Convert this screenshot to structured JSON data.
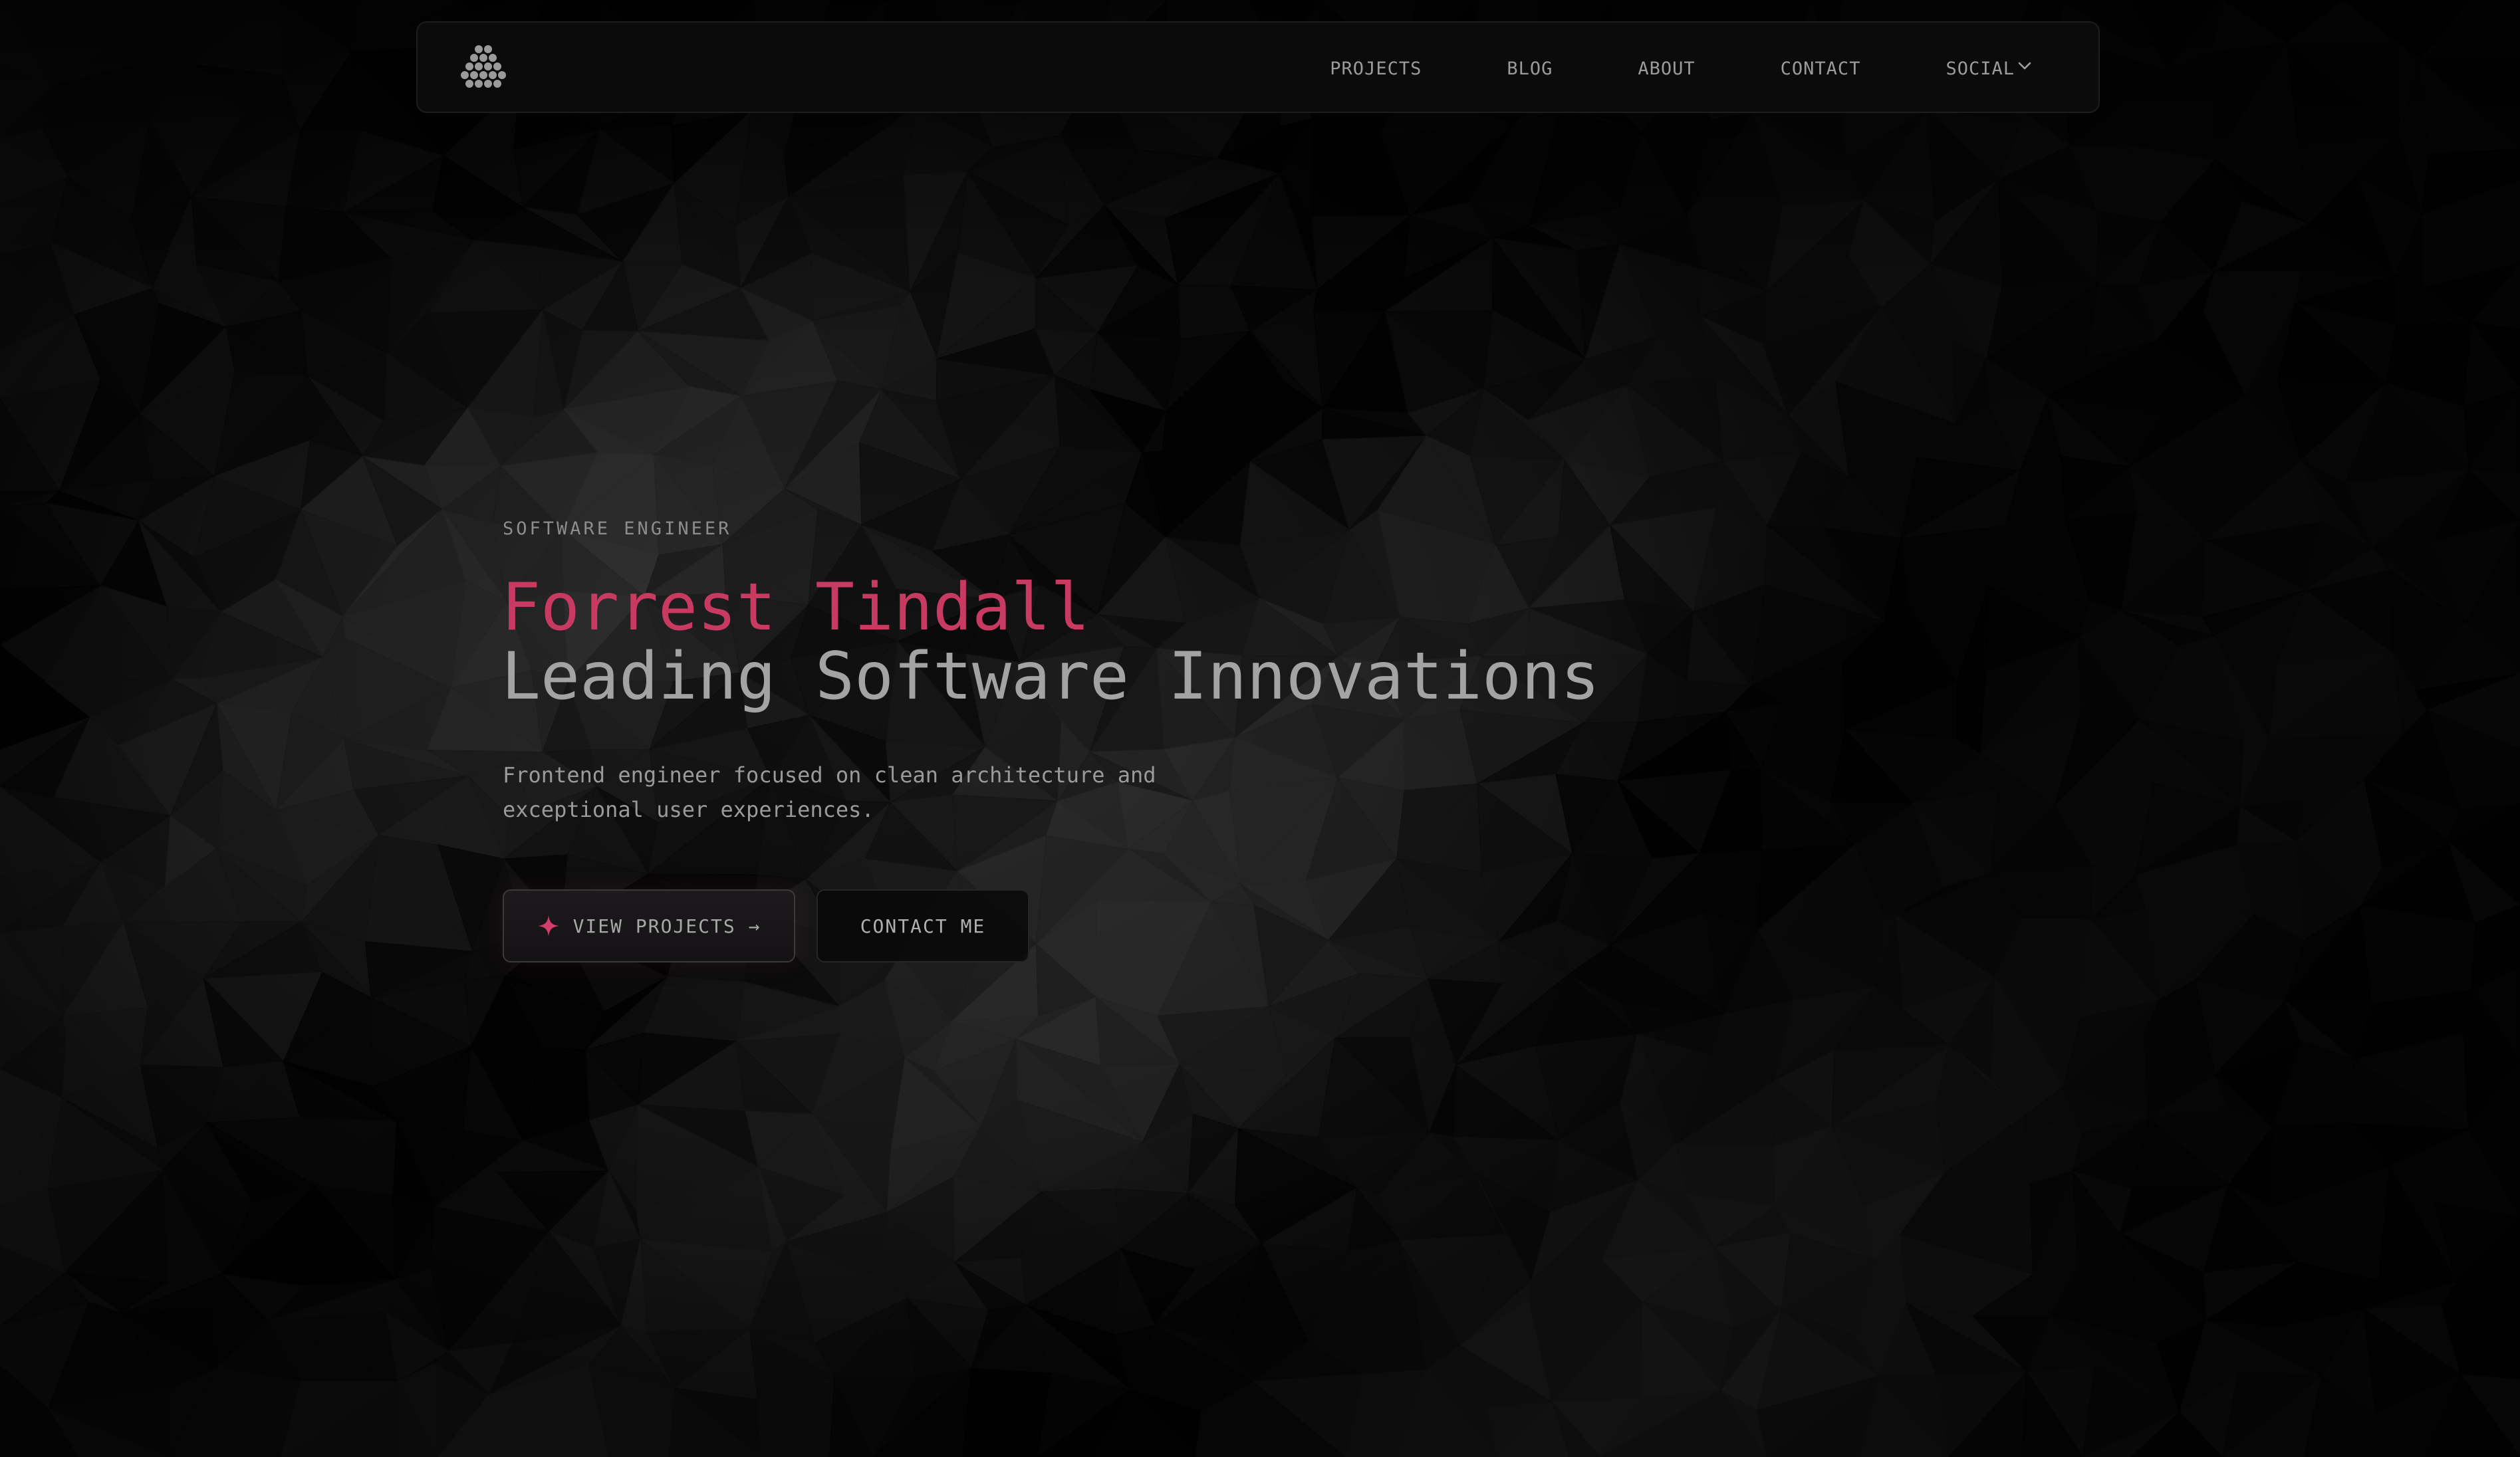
{
  "nav": {
    "logo_icon": "hexagon-cluster-logo",
    "links": [
      {
        "label": "PROJECTS"
      },
      {
        "label": "BLOG"
      },
      {
        "label": "ABOUT"
      },
      {
        "label": "CONTACT"
      }
    ],
    "social": {
      "label": "SOCIAL",
      "icon": "chevron-down-icon"
    }
  },
  "hero": {
    "eyebrow": "SOFTWARE ENGINEER",
    "name": "Forrest Tindall",
    "tagline": "Leading Software Innovations",
    "description": "Frontend engineer focused on clean architecture and exceptional user experiences.",
    "primary_button": {
      "label": "VIEW PROJECTS →",
      "icon": "sparkle-icon"
    },
    "secondary_button": {
      "label": "CONTACT ME"
    }
  },
  "colors": {
    "background": "#020202",
    "accent": "#c93a62",
    "text_muted": "#9a9a9a",
    "heading_secondary": "#a3a3a3"
  }
}
